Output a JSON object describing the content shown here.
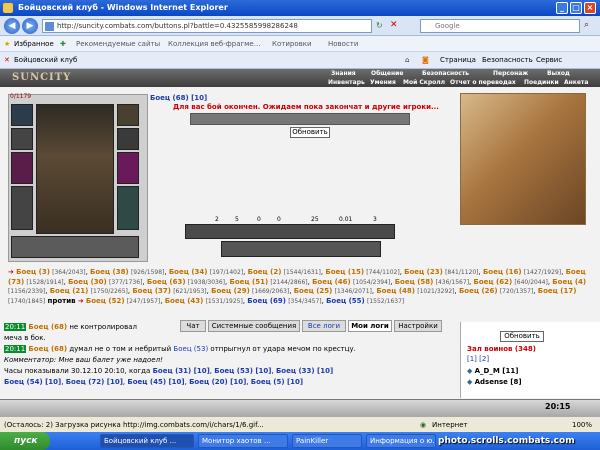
{
  "window": {
    "title": "Бойцовский клуб - Windows Internet Explorer"
  },
  "addressbar": {
    "url": "http://suncity.combats.com/buttons.pl?battle=0.4325585998286248",
    "search_placeholder": "Google"
  },
  "favorites": {
    "label": "Избранное",
    "items": [
      "Рекомендуемые сайты",
      "Коллекция веб-фрагме...",
      "Котировки",
      "Новости"
    ]
  },
  "tabs": {
    "active": "Бойцовский клуб",
    "tools": [
      "Страница",
      "Безопасность",
      "Сервис"
    ]
  },
  "game": {
    "logo": "SUNCITY",
    "menu_top": [
      "Знания",
      "Общение",
      "Безопасность",
      "Персонаж",
      "Выход"
    ],
    "menu_bottom": [
      "Инвентарь",
      "Умения",
      "Мой Скролл",
      "Отчет о переводах",
      "Поединки",
      "Анкета"
    ],
    "hp": "0/1179",
    "fighter_name": "Боец (68) [10]",
    "fight_message": "Для вас бой окончен. Ожидаем пока закончат и другие игроки...",
    "refresh_label": "Обновить",
    "stats": [
      "2",
      "5",
      "0",
      "0",
      "25",
      "0.01",
      "3"
    ],
    "log_line1": [
      {
        "n": "Боец (3)",
        "p": "[364/2043]"
      },
      {
        "n": "Боец (38)",
        "p": "[926/1598]"
      },
      {
        "n": "Боец (34)",
        "p": "[197/1402]"
      },
      {
        "n": "Боец (2)",
        "p": "[1544/1631]"
      },
      {
        "n": "Боец (15)",
        "p": "[744/1102]"
      },
      {
        "n": "Боец (23)",
        "p": "[841/1120]"
      }
    ],
    "log_line2": [
      {
        "n": "Боец (16)",
        "p": "[1427/1929]"
      },
      {
        "n": "Боец (73)",
        "p": "[1528/1914]"
      },
      {
        "n": "Боец (30)",
        "p": "[377/1736]"
      },
      {
        "n": "Боец (63)",
        "p": "[1938/3036]"
      },
      {
        "n": "Боец (51)",
        "p": "[2144/2866]"
      },
      {
        "n": "Боец (46)",
        "p": "[1054/2394]"
      }
    ],
    "log_line3": [
      {
        "n": "Боец (58)",
        "p": "[436/1567]"
      },
      {
        "n": "Боец (62)",
        "p": "[640/2044]"
      },
      {
        "n": "Боец (4)",
        "p": "[1156/2339]"
      },
      {
        "n": "Боец (21)",
        "p": "[1750/2265]"
      },
      {
        "n": "Боец (37)",
        "p": "[621/1953]"
      },
      {
        "n": "Боец (29)",
        "p": "[1669/2063]"
      }
    ],
    "log_line4": [
      {
        "n": "Боец (25)",
        "p": "[1346/2071]"
      },
      {
        "n": "Боец (48)",
        "p": "[1021/3292]"
      },
      {
        "n": "Боец (26)",
        "p": "[720/1357]"
      },
      {
        "n": "Боец (17)",
        "p": "[1740/1845]"
      }
    ],
    "log_versus": "против",
    "log_line4b": [
      {
        "n": "Боец (52)",
        "p": "[247/1957]"
      },
      {
        "n": "Боец (43)",
        "p": "[1531/1925]"
      }
    ],
    "log_line5": [
      {
        "n": "Боец (69)",
        "p": "[354/3457]"
      },
      {
        "n": "Боец (55)",
        "p": "[1552/1637]"
      }
    ]
  },
  "chat": {
    "tabs": [
      "Чат",
      "Системные сообщения",
      "Все логи",
      "Мои логи",
      "Настройки"
    ],
    "lines": [
      {
        "ts": "20:11",
        "name": "Боец (68)",
        "text": "не контролировал"
      },
      {
        "plain": "меча в бок."
      },
      {
        "ts": "20:11",
        "name": "Боец (68)",
        "text": "думал не о том и небритый",
        "target": "Боец (53)",
        "text2": "отпрыгнул от удара мечом по крестцу."
      },
      {
        "italic": "Комментатор: Мне ваш балет уже надоел!"
      },
      {
        "plain": "Часы показывали 30.12.10 20:10, когда"
      }
    ],
    "fighters_row1": [
      "Боец (31) [10]",
      "Боец (53) [10]",
      "Боец (33) [10]"
    ],
    "fighters_row2": [
      "Боец (54) [10]",
      "Боец (72) [10]",
      "Боец (45) [10]",
      "Боец (20) [10]",
      "Боец (5) [10]"
    ]
  },
  "hall": {
    "refresh_label": "Обновить",
    "title": "Зал воинов (348)",
    "pages": "[1] [2]",
    "users": [
      "A_D_M [11]",
      "Adsense [8]"
    ]
  },
  "clock": "20:15",
  "status": {
    "text": "(Осталось: 2) Загрузка рисунка http://img.combats.com/i/chars/1/6.gif...",
    "zone": "Интернет",
    "zoom": "100%"
  },
  "taskbar": {
    "start": "пуск",
    "tasks": [
      "Бойцовский клуб ...",
      "Монитор хаотов ...",
      "PainKiller",
      "Информация о ю..."
    ],
    "watermark": "photo.scrolls.combats.com"
  },
  "colors": {
    "fighter_name": "#c07000",
    "fighter_blue": "#1a3bb0",
    "alert": "#cc0000",
    "timestamp_bg": "#0a8c2a"
  }
}
